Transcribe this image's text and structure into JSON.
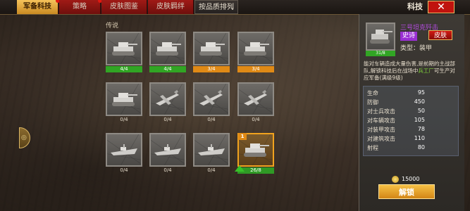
{
  "tabs": [
    {
      "label": "军备科技"
    },
    {
      "label": "策略"
    },
    {
      "label": "皮肤图鉴"
    },
    {
      "label": "皮肤羁绊"
    }
  ],
  "sort_label": "按品质排列",
  "header_title": "科技",
  "section_label": "传说",
  "cards": [
    {
      "icon": "tank-icon",
      "progress": "4/4",
      "bar": "green"
    },
    {
      "icon": "tank-icon",
      "progress": "4/4",
      "bar": "green"
    },
    {
      "icon": "tank-icon",
      "progress": "3/4",
      "bar": "orange"
    },
    {
      "icon": "tank-icon",
      "progress": "3/4",
      "bar": "orange"
    },
    {
      "icon": "tank-icon",
      "progress": "0/4",
      "bar": "plain"
    },
    {
      "icon": "plane-icon",
      "progress": "0/4",
      "bar": "plain"
    },
    {
      "icon": "plane-icon",
      "progress": "0/4",
      "bar": "plain"
    },
    {
      "icon": "plane-icon",
      "progress": "0/4",
      "bar": "plain"
    },
    {
      "icon": "ship-icon",
      "progress": "0/4",
      "bar": "plain"
    },
    {
      "icon": "ship-icon",
      "progress": "0/4",
      "bar": "plain"
    },
    {
      "icon": "ship-icon",
      "progress": "0/4",
      "bar": "plain"
    },
    {
      "icon": "tank-icon",
      "progress": "26/8",
      "bar": "selected",
      "level": "1"
    }
  ],
  "detail": {
    "thumb_progress": "31/8",
    "name": "三号坦克歼击",
    "rarity": "史诗",
    "skin_button": "皮肤",
    "type": "类型：装甲",
    "description_pre": "能对车辆造成大量伤害,是前期的主战部队,解锁科技后在战场中",
    "description_hl": "兵工厂",
    "description_post": "可生产对应军备(满级9级)",
    "stats": [
      {
        "label": "生命",
        "value": "95"
      },
      {
        "label": "防御",
        "value": "450"
      },
      {
        "label": "对士兵攻击",
        "value": "50"
      },
      {
        "label": "对车辆攻击",
        "value": "105"
      },
      {
        "label": "对装甲攻击",
        "value": "78"
      },
      {
        "label": "对建筑攻击",
        "value": "110"
      },
      {
        "label": "射程",
        "value": "80"
      }
    ],
    "cost": "15000",
    "unlock_button": "解锁"
  },
  "colors": {
    "active_tab": "#f0b040",
    "tab": "#a01a16",
    "rarity": "#9a2fd2",
    "highlight": "#7fd43a"
  }
}
